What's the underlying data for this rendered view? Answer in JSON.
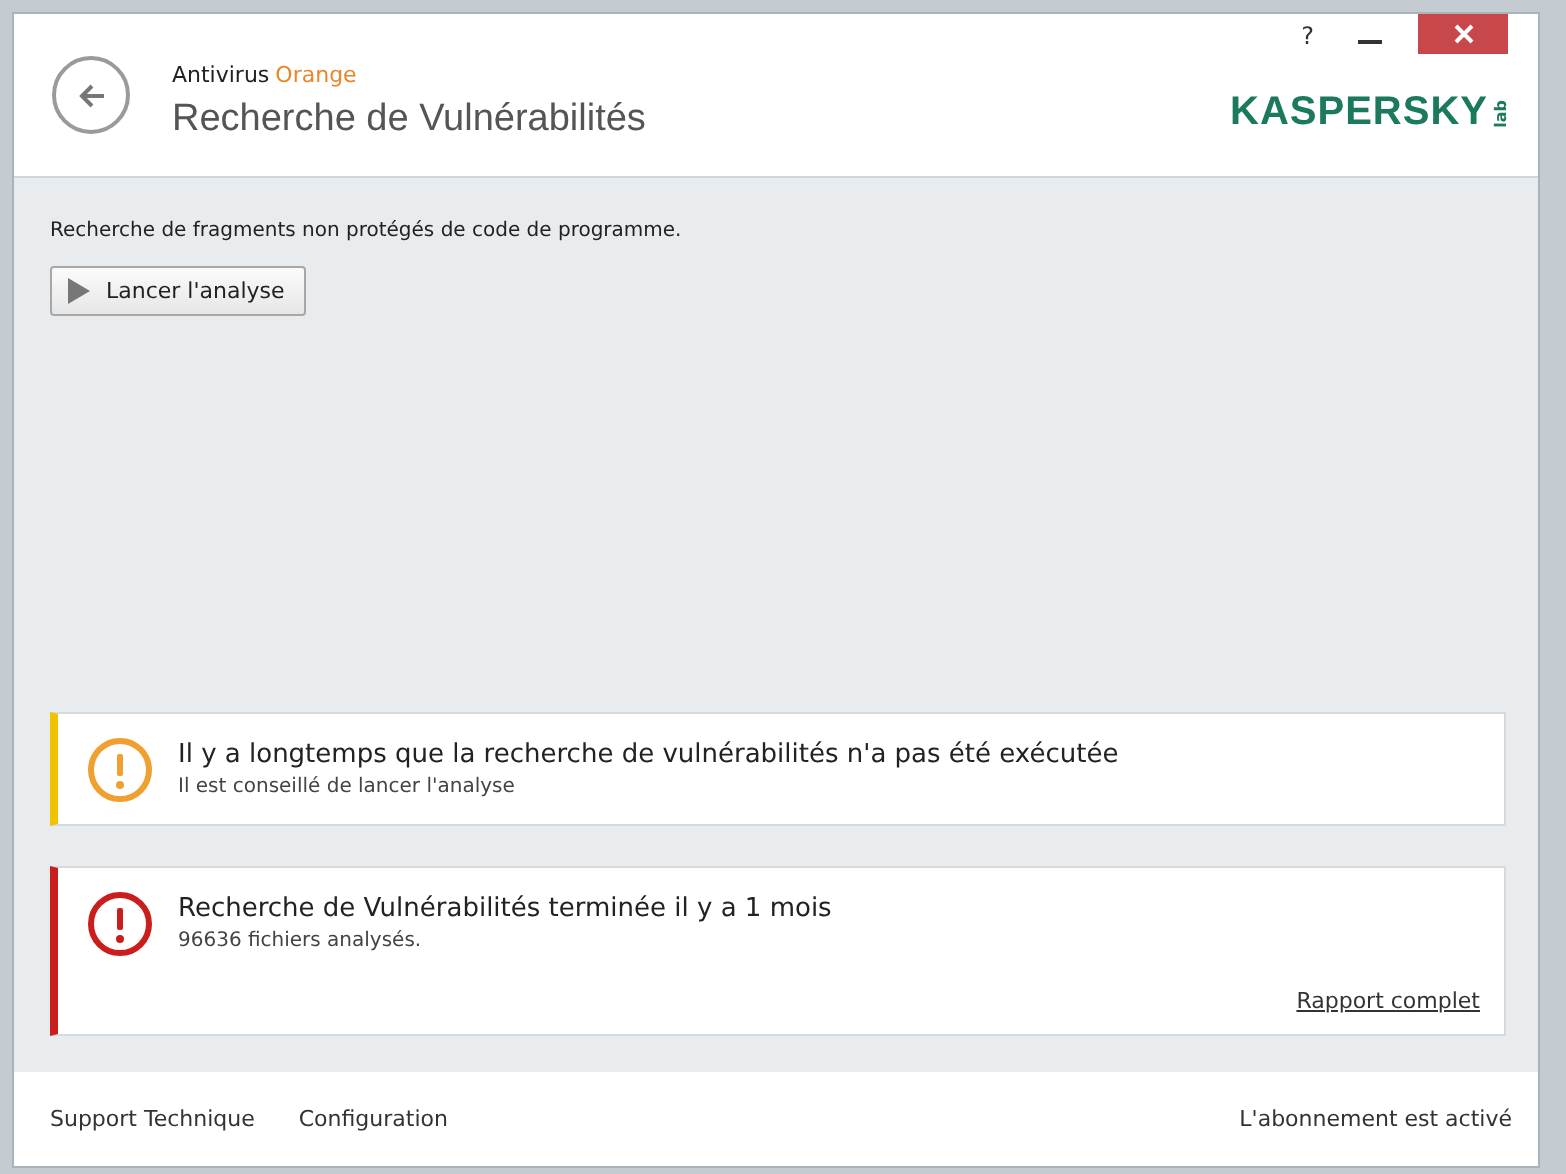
{
  "window": {
    "controls": [
      "?"
    ]
  },
  "header": {
    "product": "Antivirus",
    "edition": "Orange",
    "title": "Recherche de Vulnérabilités",
    "logo": {
      "name": "KASPERSKY",
      "suffix": "lab"
    }
  },
  "content": {
    "description": "Recherche de fragments non protégés de code de programme.",
    "action_button": "Lancer l'analyse"
  },
  "alerts": [
    {
      "kind": "warning",
      "title": "Il y a longtemps que la recherche de vulnérabilités n'a pas été exécutée",
      "subtitle": "Il est conseillé de lancer l'analyse"
    },
    {
      "kind": "critical",
      "title": "Recherche de Vulnérabilités terminée il y a 1 mois",
      "subtitle": "96636 fichiers analysés.",
      "link": "Rapport complet"
    }
  ],
  "footer": {
    "links": [
      "Support Technique",
      "Configuration"
    ],
    "status": "L'abonnement est activé"
  }
}
